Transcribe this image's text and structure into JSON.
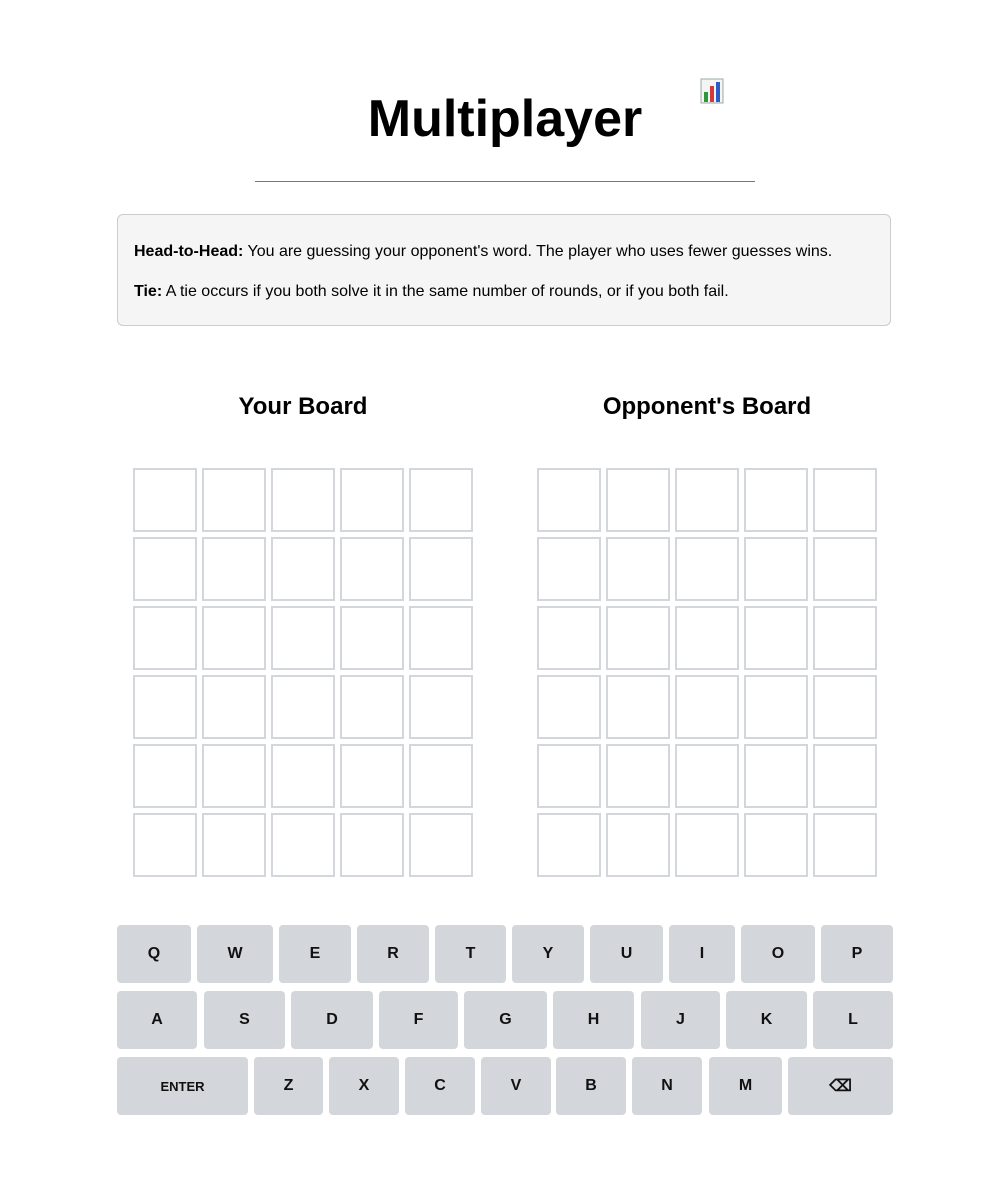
{
  "header": {
    "title": "Multiplayer",
    "stats_icon": "bar-chart-icon"
  },
  "rules": [
    {
      "label": "Head-to-Head:",
      "text": " You are guessing your opponent's word. The player who uses fewer guesses wins."
    },
    {
      "label": "Tie:",
      "text": " A tie occurs if you both solve it in the same number of rounds, or if you both fail."
    }
  ],
  "boards": {
    "you": {
      "title": "Your Board",
      "rows": 6,
      "cols": 5
    },
    "opponent": {
      "title": "Opponent's Board",
      "rows": 6,
      "cols": 5
    }
  },
  "keyboard": {
    "rows": [
      [
        "Q",
        "W",
        "E",
        "R",
        "T",
        "Y",
        "U",
        "I",
        "O",
        "P"
      ],
      [
        "A",
        "S",
        "D",
        "F",
        "G",
        "H",
        "J",
        "K",
        "L"
      ],
      [
        "ENTER",
        "Z",
        "X",
        "C",
        "V",
        "B",
        "N",
        "M",
        "⌫"
      ]
    ]
  },
  "colors": {
    "key_bg": "#d3d6da",
    "tile_border": "#d3d6da",
    "rules_bg": "#f5f5f5"
  }
}
